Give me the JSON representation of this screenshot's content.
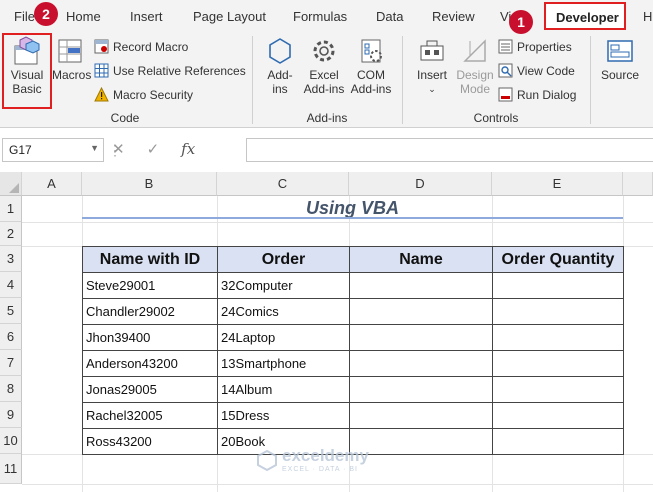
{
  "ribbon_tabs": {
    "file": "File",
    "home": "Home",
    "insert": "Insert",
    "page_layout": "Page Layout",
    "formulas": "Formulas",
    "data": "Data",
    "review": "Review",
    "view": "Vi",
    "developer": "Developer",
    "help": "H"
  },
  "badges": {
    "step1": "1",
    "step2": "2"
  },
  "code_group": {
    "label": "Code",
    "visual_basic": "Visual\nBasic",
    "macros": "Macros",
    "record_macro": "Record Macro",
    "relative_refs": "Use Relative References",
    "macro_security": "Macro Security"
  },
  "addins_group": {
    "label": "Add-ins",
    "addins": "Add-\nins",
    "excel_addins": "Excel\nAdd-ins",
    "com_addins": "COM\nAdd-ins"
  },
  "controls_group": {
    "label": "Controls",
    "insert": "Insert",
    "design_mode": "Design\nMode",
    "properties": "Properties",
    "view_code": "View Code",
    "run_dialog": "Run Dialog"
  },
  "xml_group": {
    "source": "Source"
  },
  "formula_bar": {
    "name_box": "G17",
    "formula": ""
  },
  "grid": {
    "columns": [
      "A",
      "B",
      "C",
      "D",
      "E"
    ],
    "rows": [
      "1",
      "2",
      "3",
      "4",
      "5",
      "6",
      "7",
      "8",
      "9",
      "10",
      "11"
    ]
  },
  "sheet": {
    "title": "Using VBA",
    "headers": [
      "Name with ID",
      "Order",
      "Name",
      "Order Quantity"
    ],
    "rows": [
      [
        "Steve29001",
        "32Computer",
        "",
        ""
      ],
      [
        "Chandler29002",
        "24Comics",
        "",
        ""
      ],
      [
        "Jhon39400",
        "24Laptop",
        "",
        ""
      ],
      [
        "Anderson43200",
        "13Smartphone",
        "",
        ""
      ],
      [
        "Jonas29005",
        "14Album",
        "",
        ""
      ],
      [
        "Rachel32005",
        "15Dress",
        "",
        ""
      ],
      [
        "Ross43200",
        "20Book",
        "",
        ""
      ]
    ]
  },
  "watermark": {
    "name": "exceldemy",
    "tagline": "EXCEL · DATA · BI"
  },
  "colors": {
    "highlight": "#e02020",
    "badge": "#c8102e",
    "header_fill": "#d9e1f2",
    "title": "#44546a"
  }
}
